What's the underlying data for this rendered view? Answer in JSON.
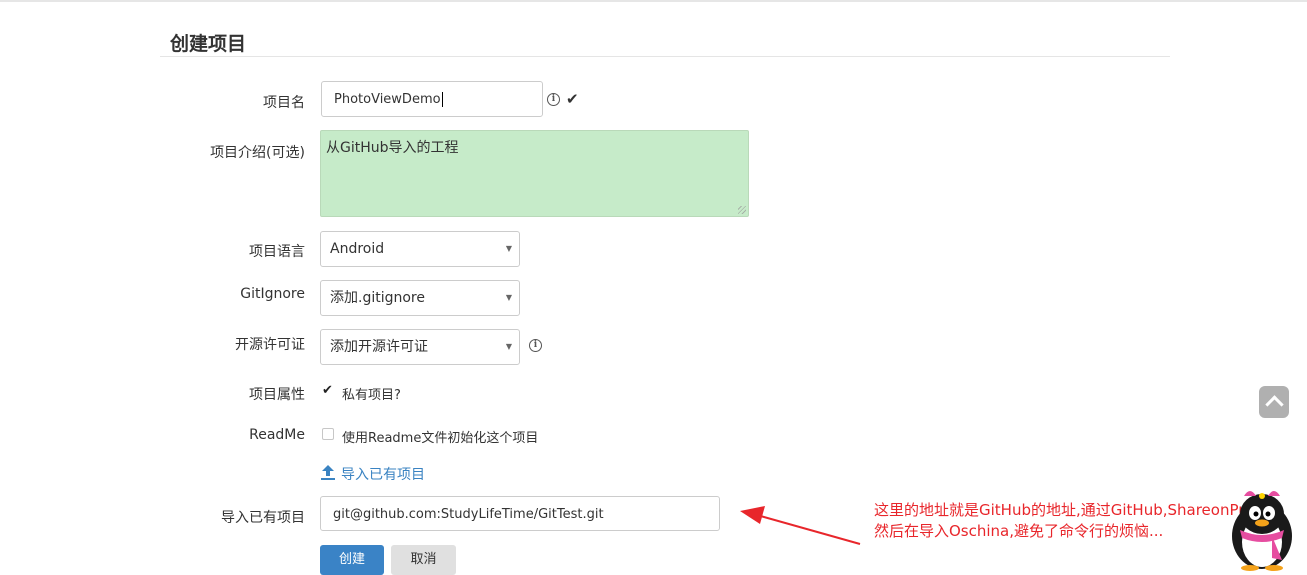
{
  "page": {
    "title": "创建项目"
  },
  "form": {
    "name_label": "项目名",
    "name_value": "PhotoViewDemo",
    "desc_label": "项目介绍(可选)",
    "desc_value": "从GitHub导入的工程",
    "language_label": "项目语言",
    "language_value": "Android",
    "gitignore_label": "GitIgnore",
    "gitignore_value": "添加.gitignore",
    "license_label": "开源许可证",
    "license_value": "添加开源许可证",
    "attr_label": "项目属性",
    "private_text": "私有项目?",
    "private_checked": true,
    "readme_label": "ReadMe",
    "readme_text": "使用Readme文件初始化这个项目",
    "readme_checked": false,
    "import_link_text": "导入已有项目",
    "import_label": "导入已有项目",
    "import_value": "git@github.com:StudyLifeTime/GitTest.git",
    "create_button": "创建",
    "cancel_button": "取消"
  },
  "annotation": {
    "line1": "这里的地址就是GitHub的地址,通过GitHub,ShareonProject",
    "line2": "然后在导入Oschina,避免了命令行的烦恼..."
  },
  "icons": {
    "info": "info-circle-icon",
    "valid": "checkmark-icon",
    "upload": "upload-icon",
    "scroll_top": "chevron-up-icon",
    "mascot": "qq-penguin-icon"
  },
  "colors": {
    "accent": "#3a83c6",
    "textarea_bg": "#c6ebc9",
    "annotation": "#e8262b"
  }
}
